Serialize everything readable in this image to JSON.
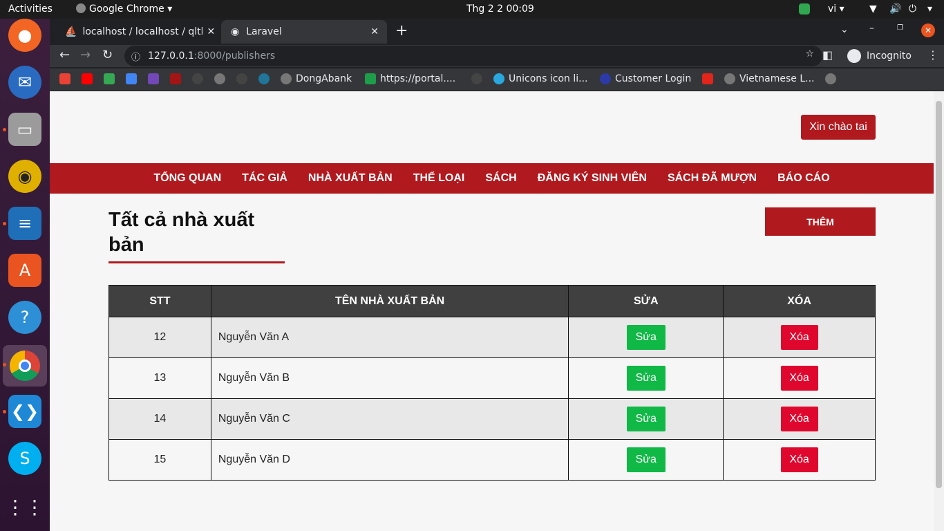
{
  "system": {
    "activities": "Activities",
    "app_name": "Google Chrome",
    "clock": "Thg 2 2  00:09",
    "lang": "vi"
  },
  "browser": {
    "tabs": [
      {
        "label": "localhost / localhost / qlth"
      },
      {
        "label": "Laravel"
      }
    ],
    "url_host": "127.0.0.1",
    "url_rest": ":8000/publishers",
    "incognito": "Incognito",
    "bookmarks": [
      {
        "label": "DongAbank"
      },
      {
        "label": "https://portal...."
      },
      {
        "label": "Unicons icon li..."
      },
      {
        "label": "Customer Login"
      },
      {
        "label": "Vietnamese L..."
      }
    ]
  },
  "page": {
    "greeting": "Xin chào tai",
    "nav": [
      "TỔNG QUAN",
      "TÁC GIẢ",
      "NHÀ XUẤT BẢN",
      "THỂ LOẠI",
      "SÁCH",
      "ĐĂNG KÝ SINH VIÊN",
      "SÁCH ĐÃ MƯỢN",
      "BÁO CÁO"
    ],
    "title": "Tất cả nhà xuất bản",
    "add_label": "THÊM",
    "table": {
      "headers": [
        "STT",
        "TÊN NHÀ XUẤT BẢN",
        "SỬA",
        "XÓA"
      ],
      "rows": [
        {
          "stt": "12",
          "name": "Nguyễn Văn A",
          "edit": "Sửa",
          "delete": "Xóa"
        },
        {
          "stt": "13",
          "name": "Nguyễn Văn B",
          "edit": "Sửa",
          "delete": "Xóa"
        },
        {
          "stt": "14",
          "name": "Nguyễn Văn C",
          "edit": "Sửa",
          "delete": "Xóa"
        },
        {
          "stt": "15",
          "name": "Nguyễn Văn D",
          "edit": "Sửa",
          "delete": "Xóa"
        }
      ]
    }
  },
  "colors": {
    "brand_red": "#b0191e",
    "edit_green": "#10b846",
    "delete_red": "#e0072e",
    "header_dark": "#404040"
  }
}
